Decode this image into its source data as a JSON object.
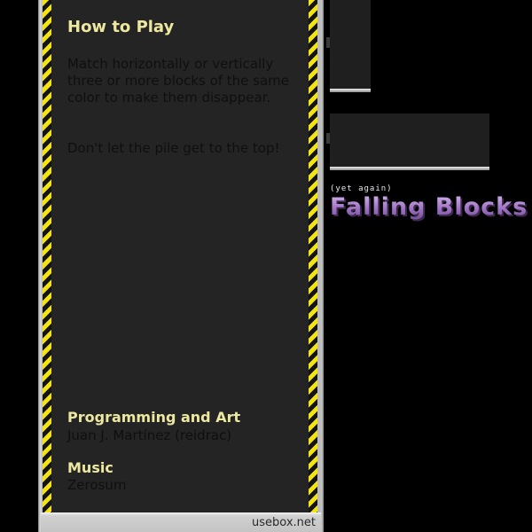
{
  "instructions": {
    "title": "How to Play",
    "rules": [
      "Match horizontally or vertically three or more blocks of the same color to make them disappear.",
      "Don't let the pile get to the top!"
    ]
  },
  "credits": {
    "programming_title": "Programming and Art",
    "programming_name": "Juan J. Martínez (reidrac)",
    "music_title": "Music",
    "music_name": "Zerosum"
  },
  "footer": {
    "site": "usebox.net"
  },
  "logo": {
    "subtitle": "(yet again)",
    "title": "Falling Blocks"
  },
  "colors": {
    "background": "#000000",
    "well": "#242424",
    "heading": "#ede8a0",
    "hazard_yellow": "#f2e311",
    "logo_purple": "#b48fd0"
  }
}
